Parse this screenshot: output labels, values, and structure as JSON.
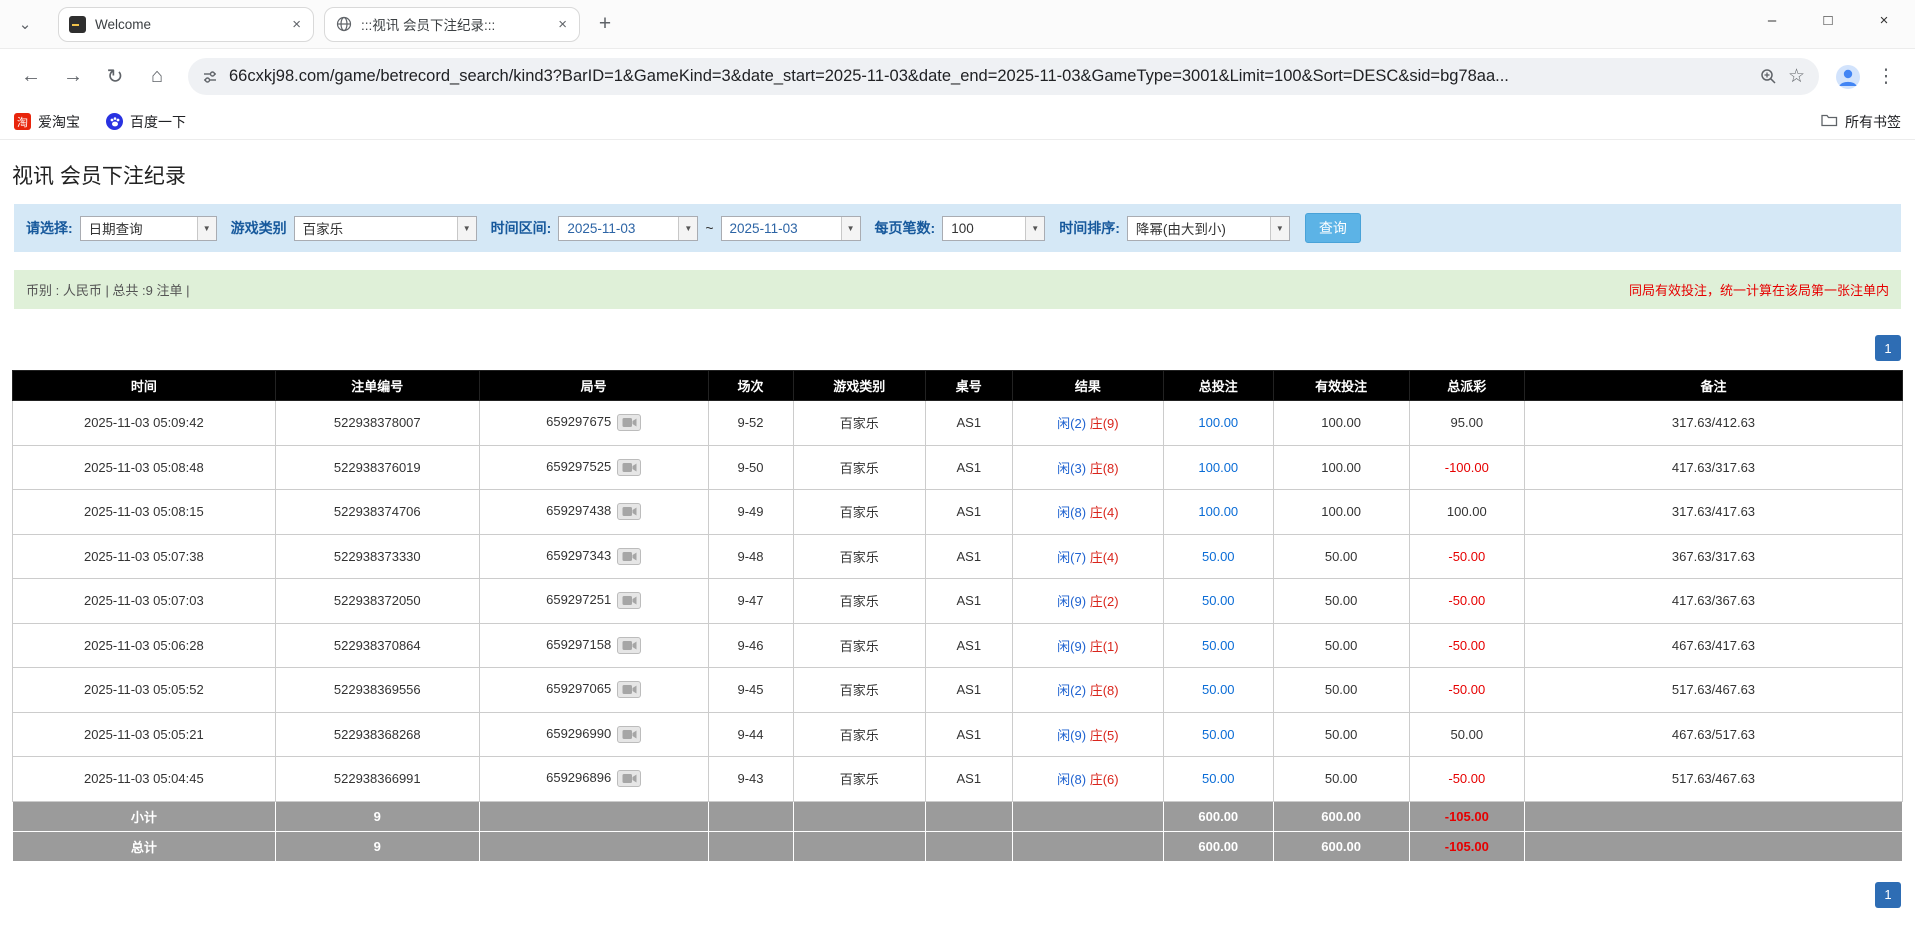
{
  "colors": {
    "accent_blue": "#2e6db4",
    "link_blue": "#0a6cd6",
    "player_blue": "#1e62d0",
    "banker_red": "#d9251c",
    "negative_red": "#e60000",
    "filterbar_blue": "#d5e8f6",
    "summary_green": "#dff0d8",
    "header_black": "#000000",
    "footer_gray": "#9b9b9b"
  },
  "icons": {
    "chevron_down": "⌄",
    "close_tab": "×",
    "new_tab": "+",
    "back": "←",
    "forward": "→",
    "refresh": "↻",
    "home": "⌂",
    "star": "☆",
    "menu_dots": "⋮",
    "minimize": "–",
    "maximize": "□",
    "close_window": "×",
    "dropdown_arrow": "▼",
    "taobao_glyph": "淘"
  },
  "browser": {
    "tabs": [
      {
        "title": "Welcome"
      },
      {
        "title": ":::视讯 会员下注纪录:::"
      }
    ],
    "url": "66cxkj98.com/game/betrecord_search/kind3?BarID=1&GameKind=3&date_start=2025-11-03&date_end=2025-11-03&GameType=3001&Limit=100&Sort=DESC&sid=bg78aa...",
    "bookmarks": {
      "items": [
        {
          "label": "爱淘宝"
        },
        {
          "label": "百度一下"
        }
      ],
      "all_bookmarks": "所有书签"
    }
  },
  "page": {
    "title": "视讯 会员下注纪录",
    "filters": {
      "select_label": "请选择:",
      "select_value": "日期查询",
      "game_type_label": "游戏类别",
      "game_type_value": "百家乐",
      "date_range_label": "时间区间:",
      "date_start": "2025-11-03",
      "date_separator": "~",
      "date_end": "2025-11-03",
      "per_page_label": "每页笔数:",
      "per_page_value": "100",
      "sort_label": "时间排序:",
      "sort_value": "降幂(由大到小)",
      "search_button": "查询"
    },
    "summary": {
      "left": "币别 : 人民币 | 总共 :9 注单 |",
      "right": "同局有效投注，统一计算在该局第一张注单内"
    },
    "pagination": "1",
    "table": {
      "headers": [
        "时间",
        "注单编号",
        "局号",
        "场次",
        "游戏类别",
        "桌号",
        "结果",
        "总投注",
        "有效投注",
        "总派彩",
        "备注"
      ],
      "rows": [
        {
          "time": "2025-11-03 05:09:42",
          "bet_id": "522938378007",
          "round_id": "659297675",
          "session": "9-52",
          "game_type": "百家乐",
          "table_id": "AS1",
          "result_player": "闲(2)",
          "result_banker": "庄(9)",
          "total_bet": "100.00",
          "valid_bet": "100.00",
          "payout": "95.00",
          "note": "317.63/412.63"
        },
        {
          "time": "2025-11-03 05:08:48",
          "bet_id": "522938376019",
          "round_id": "659297525",
          "session": "9-50",
          "game_type": "百家乐",
          "table_id": "AS1",
          "result_player": "闲(3)",
          "result_banker": "庄(8)",
          "total_bet": "100.00",
          "valid_bet": "100.00",
          "payout": "-100.00",
          "note": "417.63/317.63"
        },
        {
          "time": "2025-11-03 05:08:15",
          "bet_id": "522938374706",
          "round_id": "659297438",
          "session": "9-49",
          "game_type": "百家乐",
          "table_id": "AS1",
          "result_player": "闲(8)",
          "result_banker": "庄(4)",
          "total_bet": "100.00",
          "valid_bet": "100.00",
          "payout": "100.00",
          "note": "317.63/417.63"
        },
        {
          "time": "2025-11-03 05:07:38",
          "bet_id": "522938373330",
          "round_id": "659297343",
          "session": "9-48",
          "game_type": "百家乐",
          "table_id": "AS1",
          "result_player": "闲(7)",
          "result_banker": "庄(4)",
          "total_bet": "50.00",
          "valid_bet": "50.00",
          "payout": "-50.00",
          "note": "367.63/317.63"
        },
        {
          "time": "2025-11-03 05:07:03",
          "bet_id": "522938372050",
          "round_id": "659297251",
          "session": "9-47",
          "game_type": "百家乐",
          "table_id": "AS1",
          "result_player": "闲(9)",
          "result_banker": "庄(2)",
          "total_bet": "50.00",
          "valid_bet": "50.00",
          "payout": "-50.00",
          "note": "417.63/367.63"
        },
        {
          "time": "2025-11-03 05:06:28",
          "bet_id": "522938370864",
          "round_id": "659297158",
          "session": "9-46",
          "game_type": "百家乐",
          "table_id": "AS1",
          "result_player": "闲(9)",
          "result_banker": "庄(1)",
          "total_bet": "50.00",
          "valid_bet": "50.00",
          "payout": "-50.00",
          "note": "467.63/417.63"
        },
        {
          "time": "2025-11-03 05:05:52",
          "bet_id": "522938369556",
          "round_id": "659297065",
          "session": "9-45",
          "game_type": "百家乐",
          "table_id": "AS1",
          "result_player": "闲(2)",
          "result_banker": "庄(8)",
          "total_bet": "50.00",
          "valid_bet": "50.00",
          "payout": "-50.00",
          "note": "517.63/467.63"
        },
        {
          "time": "2025-11-03 05:05:21",
          "bet_id": "522938368268",
          "round_id": "659296990",
          "session": "9-44",
          "game_type": "百家乐",
          "table_id": "AS1",
          "result_player": "闲(9)",
          "result_banker": "庄(5)",
          "total_bet": "50.00",
          "valid_bet": "50.00",
          "payout": "50.00",
          "note": "467.63/517.63"
        },
        {
          "time": "2025-11-03 05:04:45",
          "bet_id": "522938366991",
          "round_id": "659296896",
          "session": "9-43",
          "game_type": "百家乐",
          "table_id": "AS1",
          "result_player": "闲(8)",
          "result_banker": "庄(6)",
          "total_bet": "50.00",
          "valid_bet": "50.00",
          "payout": "-50.00",
          "note": "517.63/467.63"
        }
      ],
      "subtotal": {
        "label": "小计",
        "count": "9",
        "total_bet": "600.00",
        "valid_bet": "600.00",
        "payout": "-105.00"
      },
      "total": {
        "label": "总计",
        "count": "9",
        "total_bet": "600.00",
        "valid_bet": "600.00",
        "payout": "-105.00"
      }
    }
  }
}
